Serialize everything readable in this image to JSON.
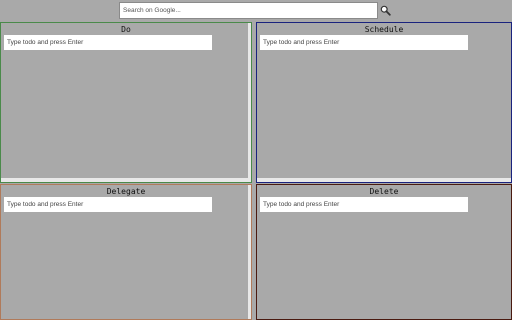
{
  "search": {
    "placeholder": "Search on Google...",
    "value": "",
    "button_icon": "magnifier-icon"
  },
  "colors": {
    "background": "#a9a9a9",
    "do_border": "#4a8a4a",
    "schedule_border": "#1a237e",
    "delegate_border": "#b07a5a",
    "delete_border": "#4a1a10"
  },
  "quadrants": {
    "do": {
      "title": "Do",
      "input_placeholder": "Type todo and press Enter",
      "input_value": ""
    },
    "schedule": {
      "title": "Schedule",
      "input_placeholder": "Type todo and press Enter",
      "input_value": ""
    },
    "delegate": {
      "title": "Delegate",
      "input_placeholder": "Type todo and press Enter",
      "input_value": ""
    },
    "delete": {
      "title": "Delete",
      "input_placeholder": "Type todo and press Enter",
      "input_value": ""
    }
  }
}
